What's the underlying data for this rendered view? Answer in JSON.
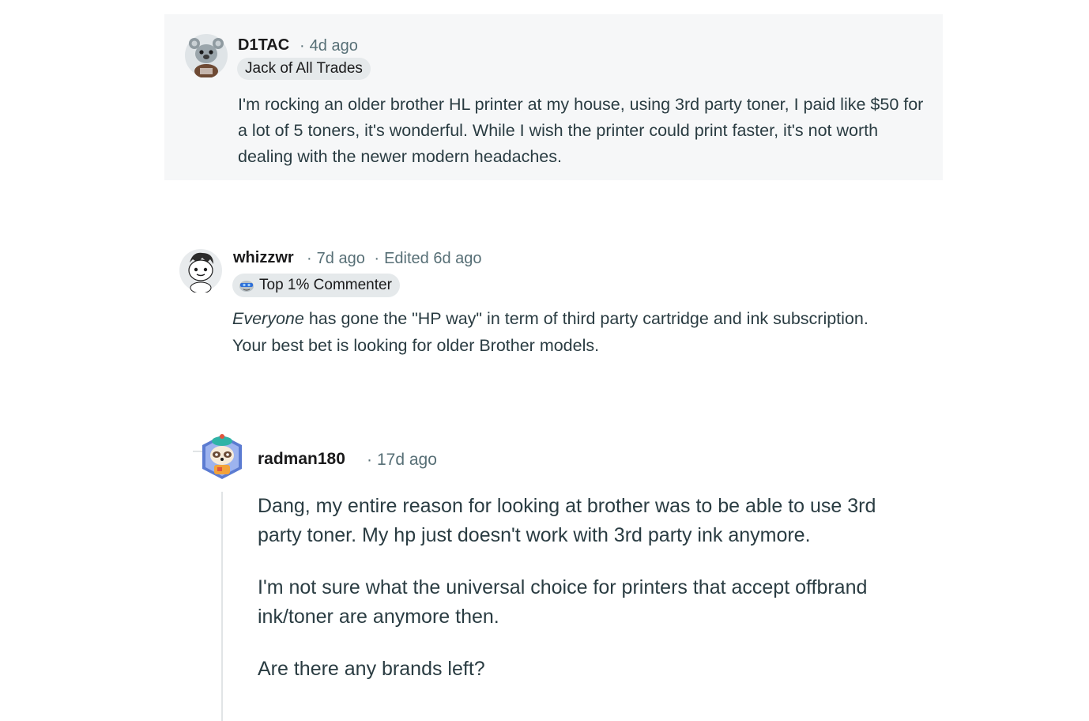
{
  "comments": [
    {
      "username": "D1TAC",
      "time": "4d ago",
      "flair": "Jack of All Trades",
      "body": "I'm rocking an older brother HL printer at my house, using 3rd party toner, I paid like $50 for a lot of 5 toners, it's wonderful. While I wish the printer could print faster, it's not worth dealing with the newer modern headaches.",
      "avatar_icon": "koala-snoo-avatar"
    },
    {
      "username": "whizzwr",
      "time": "7d ago",
      "edited": "Edited 6d ago",
      "flair": "Top 1% Commenter",
      "flair_icon": "top-commenter-icon",
      "body_emphasis": "Everyone",
      "body_rest": " has gone the \"HP way\" in term of third party cartridge and ink subscription. Your best bet is looking for older Brother models.",
      "avatar_icon": "snoo-avatar"
    },
    {
      "username": "radman180",
      "time": "17d ago",
      "paragraphs": [
        "Dang, my entire reason for looking at brother was to be able to use 3rd party toner. My hp just doesn't work with 3rd party ink anymore.",
        "I'm not sure what the universal choice for printers that accept offbrand ink/toner are anymore then.",
        "Are there any brands left?"
      ],
      "avatar_icon": "raccoon-snoo-avatar"
    }
  ],
  "separator": "·",
  "colors": {
    "highlight_bg": "#f6f7f8",
    "flair_bg": "#e5e9eb",
    "meta_text": "#576f76",
    "body_text": "#2a3c42",
    "thread_line": "#e1e4e6"
  }
}
